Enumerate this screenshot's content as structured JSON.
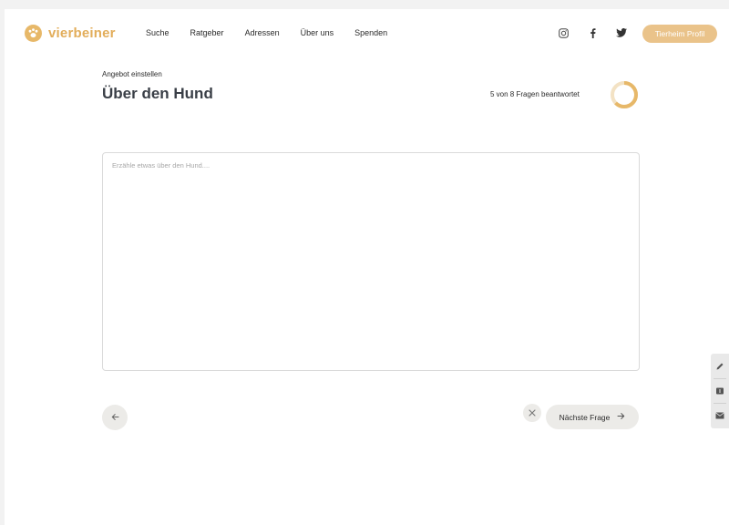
{
  "header": {
    "brand": "vierbeiner",
    "nav": [
      "Suche",
      "Ratgeber",
      "Adressen",
      "Über uns",
      "Spenden"
    ],
    "social": [
      {
        "icon": "instagram-icon"
      },
      {
        "icon": "facebook-icon"
      },
      {
        "icon": "twitter-icon"
      }
    ],
    "profile_button": "Tierheim Profil"
  },
  "form": {
    "eyebrow": "Angebot einstellen",
    "title": "Über den Hund",
    "progress_text": "5 von 8 Fragen beantwortet",
    "progress": {
      "answered": 5,
      "total": 8
    },
    "answer_placeholder": "Erzähle etwas über den Hund....",
    "answer_value": ""
  },
  "controls": {
    "back_icon": "arrow-left-icon",
    "close_icon": "close-icon",
    "next_label": "Nächste Frage",
    "next_icon": "arrow-right-icon"
  },
  "side_tab": {
    "items": [
      "pencil-icon",
      "info-icon",
      "mail-icon"
    ]
  },
  "colors": {
    "accent": "#e2ad5a",
    "accent_light": "#eac38a",
    "button_bg": "#ecebe8",
    "title": "#3a3f47"
  }
}
